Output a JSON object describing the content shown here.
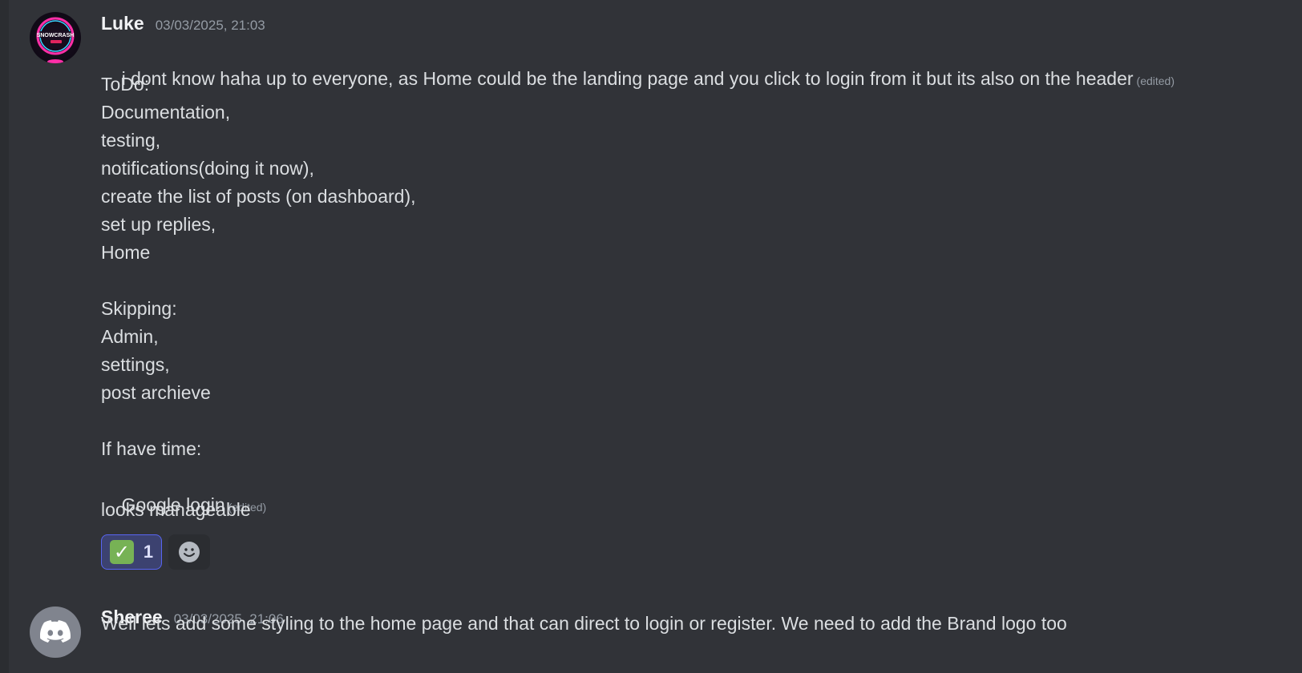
{
  "messages": [
    {
      "username": "Luke",
      "timestamp": "03/03/2025, 21:03",
      "avatar_icon": "luke-avatar-logo",
      "first_line": "i dont know haha up to everyone, as Home could be the landing page and you click to login from it but its also on the header",
      "edited_label": "(edited)",
      "lines": [
        "ToDo:",
        "Documentation,",
        "testing,",
        "notifications(doing it now),",
        "create the list of posts (on dashboard),",
        "set up replies,",
        "Home",
        "",
        "Skipping:",
        "Admin,",
        "settings,",
        "post archieve",
        "",
        "If have time:",
        "Google login"
      ],
      "second_edited_label": "(edited)",
      "followup": "looks manageable",
      "reactions": [
        {
          "emoji": "white-check-mark",
          "count": "1"
        }
      ],
      "add_reaction_icon": "smiley-add-reaction-icon"
    },
    {
      "username": "Sheree",
      "timestamp": "03/03/2025, 21:06",
      "avatar_icon": "discord-default-avatar",
      "text": "Well lets add some styling to the home page and that can direct to login or register. We need to add the Brand logo too"
    }
  ],
  "colors": {
    "background": "#313338",
    "username": "#f2f3f5",
    "timestamp": "#949ba4",
    "text": "#dbdee1",
    "reaction_border": "#5865f2"
  }
}
